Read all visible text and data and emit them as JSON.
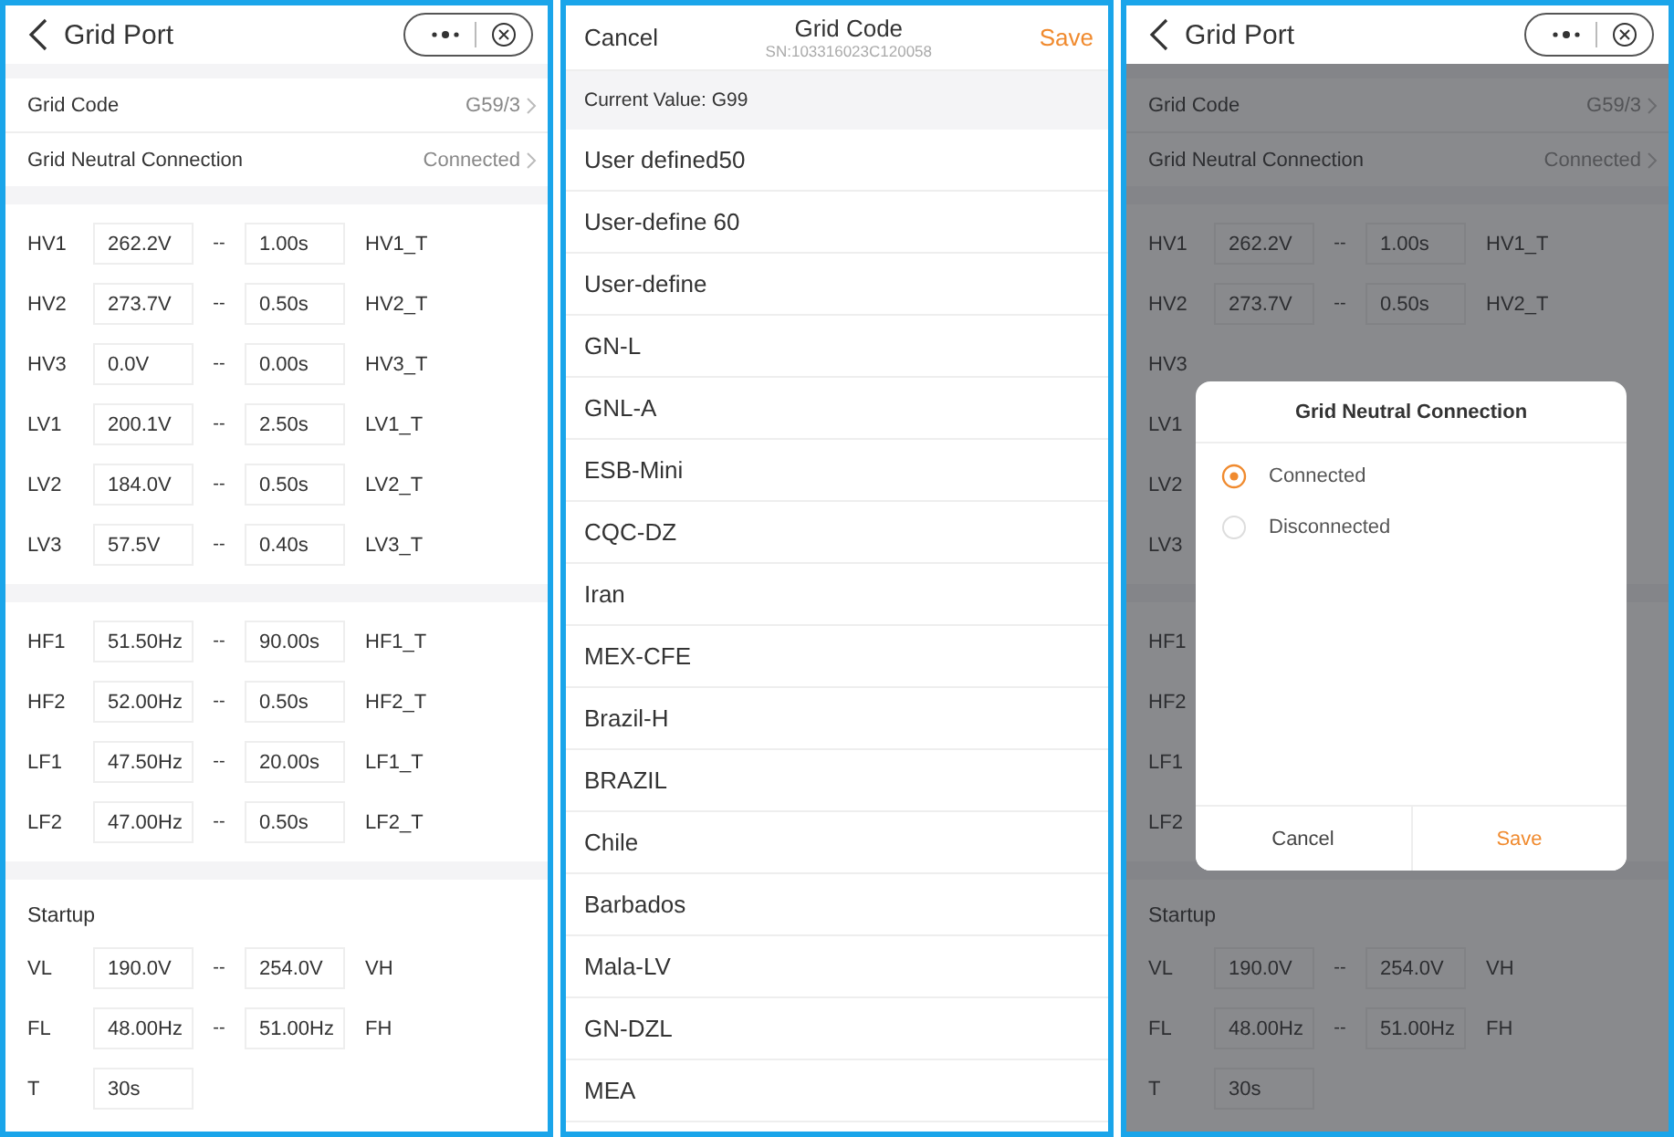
{
  "screens": [
    {
      "kind": "settings",
      "title": "Grid Port",
      "settings": [
        {
          "label": "Grid Code",
          "value": "G59/3"
        },
        {
          "label": "Grid Neutral Connection",
          "value": "Connected"
        }
      ],
      "groups": [
        {
          "rows": [
            {
              "label": "HV1",
              "value": "262.2V",
              "dash": "--",
              "value2": "1.00s",
              "label2": "HV1_T"
            },
            {
              "label": "HV2",
              "value": "273.7V",
              "dash": "--",
              "value2": "0.50s",
              "label2": "HV2_T"
            },
            {
              "label": "HV3",
              "value": "0.0V",
              "dash": "--",
              "value2": "0.00s",
              "label2": "HV3_T"
            },
            {
              "label": "LV1",
              "value": "200.1V",
              "dash": "--",
              "value2": "2.50s",
              "label2": "LV1_T"
            },
            {
              "label": "LV2",
              "value": "184.0V",
              "dash": "--",
              "value2": "0.50s",
              "label2": "LV2_T"
            },
            {
              "label": "LV3",
              "value": "57.5V",
              "dash": "--",
              "value2": "0.40s",
              "label2": "LV3_T"
            }
          ]
        },
        {
          "rows": [
            {
              "label": "HF1",
              "value": "51.50Hz",
              "dash": "--",
              "value2": "90.00s",
              "label2": "HF1_T"
            },
            {
              "label": "HF2",
              "value": "52.00Hz",
              "dash": "--",
              "value2": "0.50s",
              "label2": "HF2_T"
            },
            {
              "label": "LF1",
              "value": "47.50Hz",
              "dash": "--",
              "value2": "20.00s",
              "label2": "LF1_T"
            },
            {
              "label": "LF2",
              "value": "47.00Hz",
              "dash": "--",
              "value2": "0.50s",
              "label2": "LF2_T"
            }
          ]
        },
        {
          "heading": "Startup",
          "rows": [
            {
              "label": "VL",
              "value": "190.0V",
              "dash": "--",
              "value2": "254.0V",
              "label2": "VH"
            },
            {
              "label": "FL",
              "value": "48.00Hz",
              "dash": "--",
              "value2": "51.00Hz",
              "label2": "FH"
            },
            {
              "label": "T",
              "value": "30s"
            }
          ]
        }
      ]
    },
    {
      "kind": "picker",
      "title": "Grid Code",
      "subtitle": "SN:103316023C120058",
      "cancel": "Cancel",
      "save": "Save",
      "current": "Current Value: G99",
      "options": [
        "User defined50",
        "User-define 60",
        "User-define",
        "GN-L",
        "GNL-A",
        "ESB-Mini",
        "CQC-DZ",
        "Iran",
        "MEX-CFE",
        "Brazil-H",
        "BRAZIL",
        "Chile",
        "Barbados",
        "Mala-LV",
        "GN-DZL",
        "MEA"
      ]
    },
    {
      "kind": "settings",
      "title": "Grid Port",
      "settings": [
        {
          "label": "Grid Code",
          "value": "G59/3"
        },
        {
          "label": "Grid Neutral Connection",
          "value": "Connected"
        }
      ],
      "groups": [
        {
          "rows": [
            {
              "label": "HV1",
              "value": "262.2V",
              "dash": "--",
              "value2": "1.00s",
              "label2": "HV1_T"
            },
            {
              "label": "HV2",
              "value": "273.7V",
              "dash": "--",
              "value2": "0.50s",
              "label2": "HV2_T"
            },
            {
              "label": "HV3"
            },
            {
              "label": "LV1"
            },
            {
              "label": "LV2"
            },
            {
              "label": "LV3"
            }
          ]
        },
        {
          "rows": [
            {
              "label": "HF1"
            },
            {
              "label": "HF2"
            },
            {
              "label": "LF1"
            },
            {
              "label": "LF2"
            }
          ]
        },
        {
          "heading": "Startup",
          "rows": [
            {
              "label": "VL",
              "value": "190.0V",
              "dash": "--",
              "value2": "254.0V",
              "label2": "VH"
            },
            {
              "label": "FL",
              "value": "48.00Hz",
              "dash": "--",
              "value2": "51.00Hz",
              "label2": "FH"
            },
            {
              "label": "T",
              "value": "30s"
            }
          ]
        }
      ],
      "dialog": {
        "title": "Grid Neutral Connection",
        "options": [
          {
            "label": "Connected",
            "selected": true
          },
          {
            "label": "Disconnected",
            "selected": false
          }
        ],
        "cancel": "Cancel",
        "save": "Save"
      }
    }
  ]
}
